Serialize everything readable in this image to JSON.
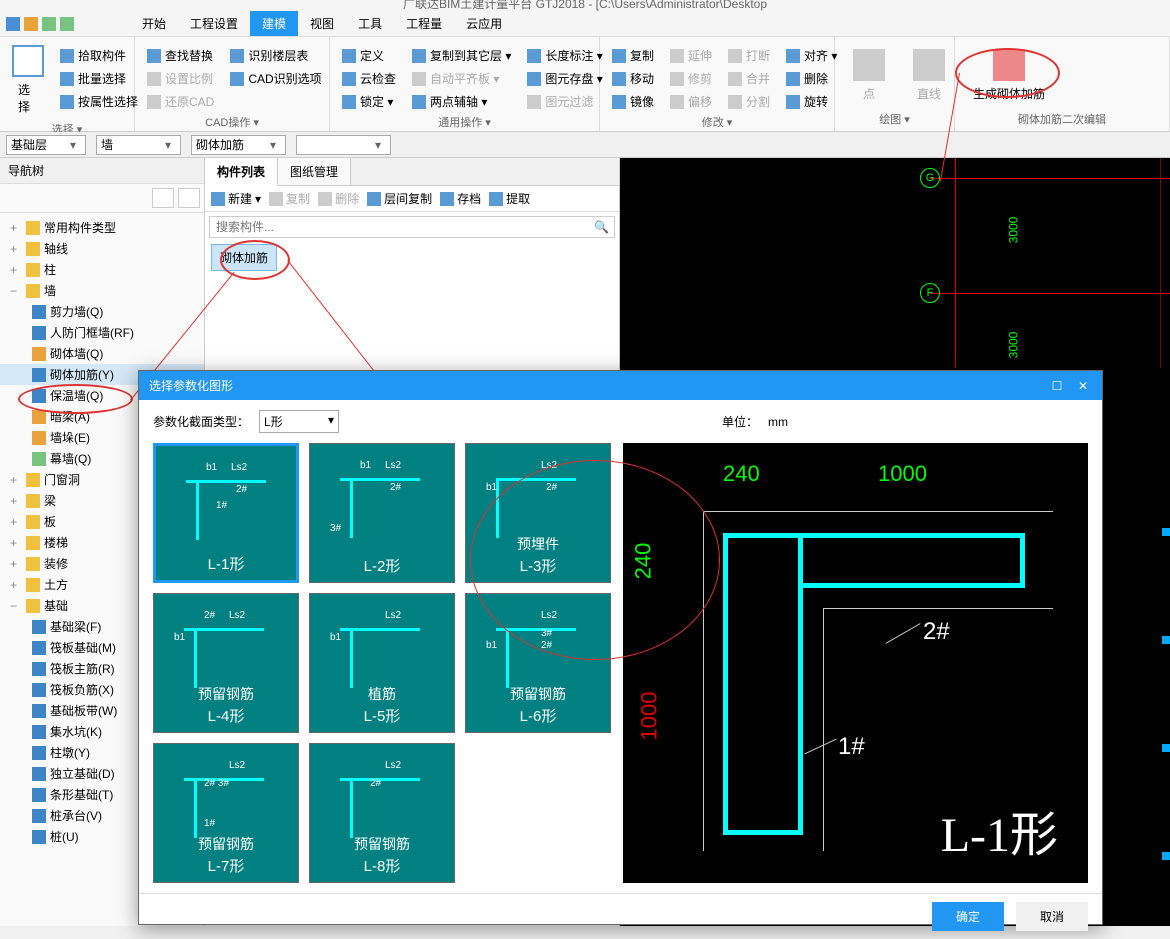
{
  "app_title": "广联达BIM土建计量平台 GTJ2018 - [C:\\Users\\Administrator\\Desktop",
  "tabs": {
    "start": "开始",
    "project": "工程设置",
    "model": "建模",
    "view": "视图",
    "tool": "工具",
    "qty": "工程量",
    "cloud": "云应用"
  },
  "ribbon": {
    "select": {
      "big": "选择",
      "pick": "拾取构件",
      "batch": "批量选择",
      "attr": "按属性选择",
      "group": "选择 ▾"
    },
    "cad": {
      "find": "查找替换",
      "scale": "设置比例",
      "restore": "还原CAD",
      "layer": "识别楼层表",
      "opt": "CAD识别选项",
      "group": "CAD操作 ▾"
    },
    "general": {
      "define": "定义",
      "cloudcheck": "云检查",
      "lock": "锁定 ▾",
      "copyfloor": "复制到其它层 ▾",
      "autoalign": "自动平齐板 ▾",
      "twopoint": "两点辅轴 ▾",
      "lendim": "长度标注 ▾",
      "stock": "图元存盘 ▾",
      "filter": "图元过滤",
      "group": "通用操作 ▾"
    },
    "modify": {
      "copy": "复制",
      "move": "移动",
      "mirror": "镜像",
      "extend": "延伸",
      "trim": "修剪",
      "offset": "偏移",
      "break": "打断",
      "merge": "合并",
      "split": "分割",
      "align": "对齐 ▾",
      "delete": "删除",
      "rotate": "旋转",
      "group": "修改 ▾"
    },
    "draw": {
      "point": "点",
      "line": "直线",
      "group": "绘图 ▾"
    },
    "special": {
      "gen": "生成砌体加筋",
      "edit": "砌体加筋二次编辑"
    }
  },
  "subbar": {
    "floor": "基础层",
    "cat": "墙",
    "type": "砌体加筋"
  },
  "left": {
    "title": "导航树",
    "items": {
      "common": "常用构件类型",
      "axis": "轴线",
      "column": "柱",
      "wall": "墙",
      "shearwall": "剪力墙(Q)",
      "rfwall": "人防门框墙(RF)",
      "masonrywall": "砌体墙(Q)",
      "masonryrebar": "砌体加筋(Y)",
      "insulation": "保温墙(Q)",
      "lintel": "暗梁(A)",
      "wallblock": "墙垛(E)",
      "curtain": "幕墙(Q)",
      "door": "门窗洞",
      "beam": "梁",
      "slab": "板",
      "stair": "楼梯",
      "deco": "装修",
      "earth": "土方",
      "found": "基础",
      "foundbeam": "基础梁(F)",
      "raft": "筏板基础(M)",
      "raftmain": "筏板主筋(R)",
      "raftneg": "筏板负筋(X)",
      "slabstrip": "基础板带(W)",
      "sump": "集水坑(K)",
      "pedestal": "柱墩(Y)",
      "isofooting": "独立基础(D)",
      "stripfooting": "条形基础(T)",
      "pilecap": "桩承台(V)",
      "pile": "桩(U)"
    }
  },
  "mid": {
    "tab1": "构件列表",
    "tab2": "图纸管理",
    "new": "新建",
    "copy": "复制",
    "delete": "删除",
    "floorcopy": "层间复制",
    "archive": "存档",
    "extract": "提取",
    "search_placeholder": "搜索构件...",
    "item": "砌体加筋"
  },
  "canvas": {
    "axis_g": "G",
    "axis_f": "F",
    "dim1": "3000",
    "dim2": "3000"
  },
  "dialog": {
    "title": "选择参数化图形",
    "section_label": "参数化截面类型：",
    "section_value": "L形",
    "unit_label": "单位：",
    "unit_value": "mm",
    "shapes": [
      {
        "name": "L-1形",
        "sub": ""
      },
      {
        "name": "L-2形",
        "sub": ""
      },
      {
        "name": "L-3形",
        "sub": "预埋件"
      },
      {
        "name": "L-4形",
        "sub": "预留钢筋"
      },
      {
        "name": "L-5形",
        "sub": "植筋"
      },
      {
        "name": "L-6形",
        "sub": "预留钢筋"
      },
      {
        "name": "L-7形",
        "sub": "预留钢筋"
      },
      {
        "name": "L-8形",
        "sub": "预留钢筋"
      }
    ],
    "preview": {
      "dim_w": "240",
      "dim_l": "1000",
      "mark1": "1#",
      "mark2": "2#",
      "label": "L-1形"
    },
    "ok": "确定",
    "cancel": "取消"
  }
}
